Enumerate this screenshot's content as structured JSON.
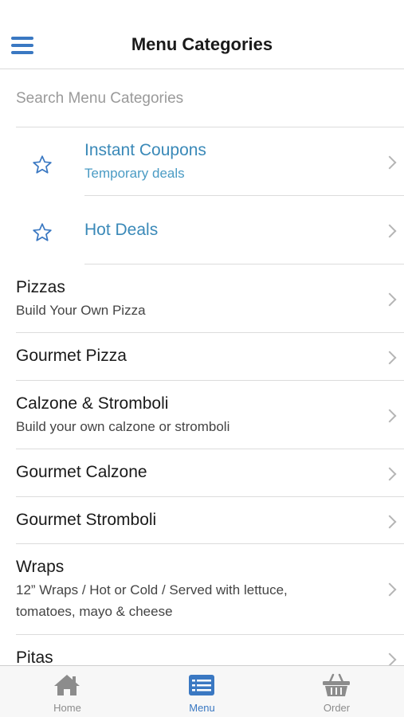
{
  "header": {
    "title": "Menu Categories"
  },
  "search": {
    "placeholder": "Search Menu Categories"
  },
  "promos": [
    {
      "title": "Instant Coupons",
      "subtitle": "Temporary deals",
      "icon": "star-icon"
    },
    {
      "title": "Hot Deals",
      "subtitle": "",
      "icon": "star-icon"
    }
  ],
  "categories": [
    {
      "title": "Pizzas",
      "subtitle": "Build Your Own Pizza"
    },
    {
      "title": "Gourmet Pizza",
      "subtitle": ""
    },
    {
      "title": "Calzone & Stromboli",
      "subtitle": "Build your own calzone or stromboli"
    },
    {
      "title": "Gourmet Calzone",
      "subtitle": ""
    },
    {
      "title": "Gourmet Stromboli",
      "subtitle": ""
    },
    {
      "title": "Wraps",
      "subtitle_line1": "12” Wraps / Hot or Cold / Served with lettuce,",
      "subtitle_line2": "tomatoes, mayo & cheese"
    },
    {
      "title": "Pitas",
      "subtitle": ""
    }
  ],
  "tabbar": {
    "home": "Home",
    "menu": "Menu",
    "order": "Order",
    "active": "menu"
  },
  "colors": {
    "accent": "#3a78c2",
    "promo_text": "#3a89b8"
  }
}
